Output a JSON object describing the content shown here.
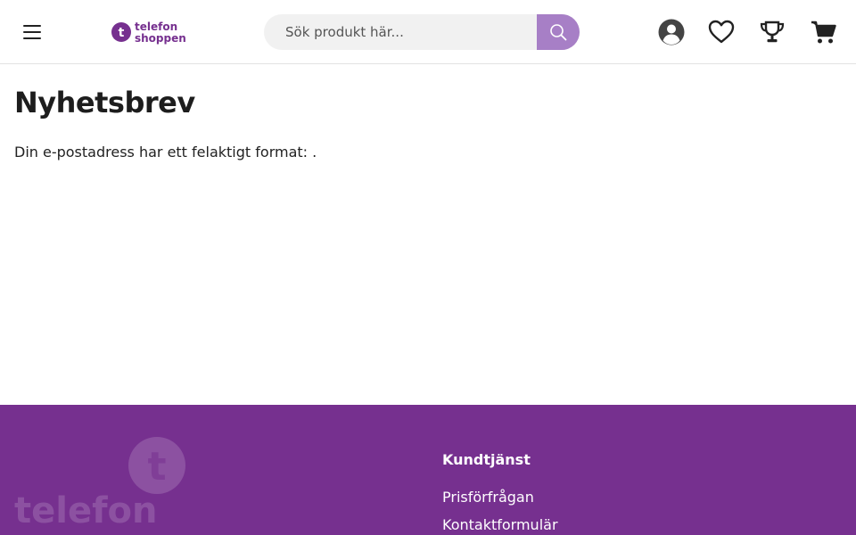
{
  "header": {
    "logo": {
      "line1": "telefon",
      "line2": "shoppen",
      "mark": "t",
      "brand_color": "#76308f"
    },
    "search": {
      "placeholder": "Sök produkt här...",
      "button_color": "#a77fc6"
    },
    "icons": [
      "hamburger-menu-icon",
      "user-account-icon",
      "heart-icon",
      "trophy-icon",
      "shopping-cart-icon"
    ]
  },
  "main": {
    "title": "Nyhetsbrev",
    "message": "Din e-postadress har ett felaktigt format: ."
  },
  "footer": {
    "background": "#76308f",
    "logo_text": "telefon",
    "customer_service": {
      "heading": "Kundtjänst",
      "links": [
        "Prisförfrågan",
        "Kontaktformulär"
      ]
    }
  }
}
